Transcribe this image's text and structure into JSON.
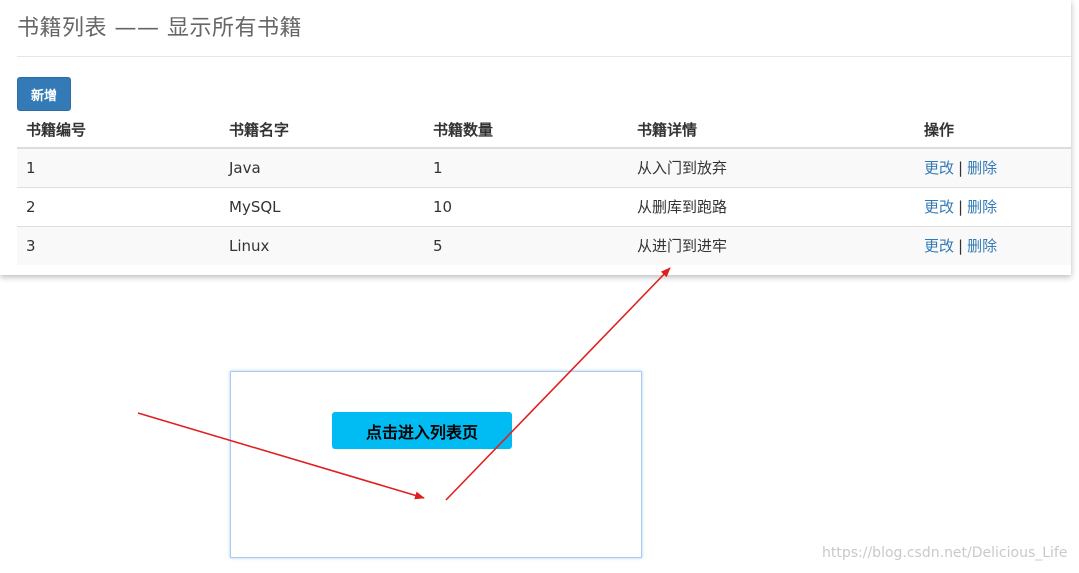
{
  "page": {
    "title": "书籍列表 —— 显示所有书籍"
  },
  "toolbar": {
    "add_label": "新增"
  },
  "table": {
    "headers": [
      "书籍编号",
      "书籍名字",
      "书籍数量",
      "书籍详情",
      "操作"
    ],
    "rows": [
      {
        "id": "1",
        "name": "Java",
        "count": "1",
        "detail": "从入门到放弃"
      },
      {
        "id": "2",
        "name": "MySQL",
        "count": "10",
        "detail": "从删库到跑路"
      },
      {
        "id": "3",
        "name": "Linux",
        "count": "5",
        "detail": "从进门到进牢"
      }
    ],
    "actions": {
      "edit_label": "更改",
      "separator": "|",
      "delete_label": "删除"
    }
  },
  "demo": {
    "enter_button_label": "点击进入列表页"
  },
  "watermark": "https://blog.csdn.net/Delicious_Life",
  "colors": {
    "primary": "#337ab7",
    "enter_button": "#00bcf2",
    "arrow": "#e02020"
  }
}
